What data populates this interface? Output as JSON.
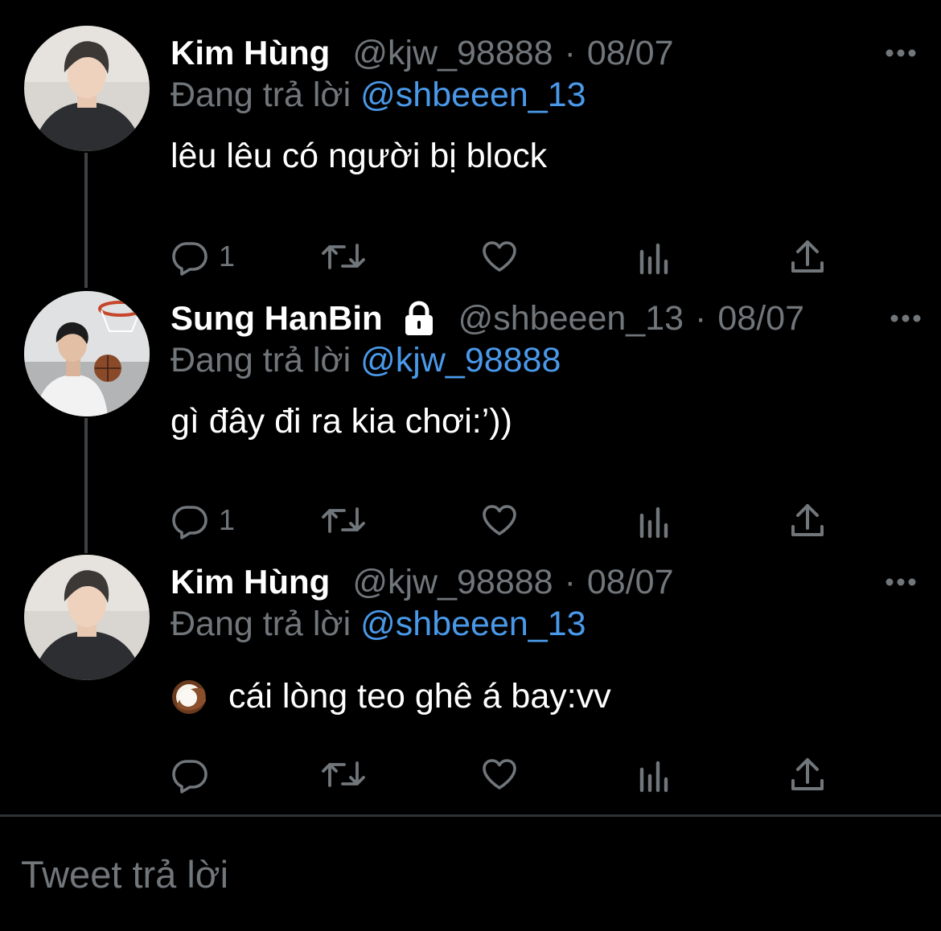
{
  "thread": {
    "tweets": [
      {
        "name": "Kim Hùng",
        "handle": "@kjw_98888",
        "separator": "·",
        "date": "08/07",
        "replying_prefix": "Đang trả lời",
        "replying_to": "@shbeeen_13",
        "text": "lêu lêu có người bị block",
        "reply_count": "1",
        "icons": [
          "reply-icon",
          "retweet-icon",
          "like-icon",
          "analytics-icon",
          "share-icon",
          "more-icon"
        ]
      },
      {
        "name": "Sung HanBin",
        "handle": "@shbeeen_13",
        "separator": "·",
        "date": "08/07",
        "replying_prefix": "Đang trả lời",
        "replying_to": "@kjw_98888",
        "text": "gì đây đi ra kia chơi:’))",
        "reply_count": "1",
        "protected": true,
        "icons": [
          "lock-icon",
          "reply-icon",
          "retweet-icon",
          "like-icon",
          "analytics-icon",
          "share-icon",
          "more-icon"
        ]
      },
      {
        "name": "Kim Hùng",
        "handle": "@kjw_98888",
        "separator": "·",
        "date": "08/07",
        "replying_prefix": "Đang trả lời",
        "replying_to": "@shbeeen_13",
        "text": "cái lòng teo ghê á bay:vv",
        "emoji": "coconut-emoji",
        "reply_count": "",
        "icons": [
          "reply-icon",
          "retweet-icon",
          "like-icon",
          "analytics-icon",
          "share-icon",
          "more-icon"
        ]
      }
    ]
  },
  "reply_box": {
    "placeholder": "Tweet trả lời"
  },
  "colors": {
    "background": "#000000",
    "primary_text": "#ffffff",
    "secondary_text": "#71767b",
    "mention": "#4a99e9",
    "thread_line": "#3e4144",
    "divider": "#2f3336"
  }
}
